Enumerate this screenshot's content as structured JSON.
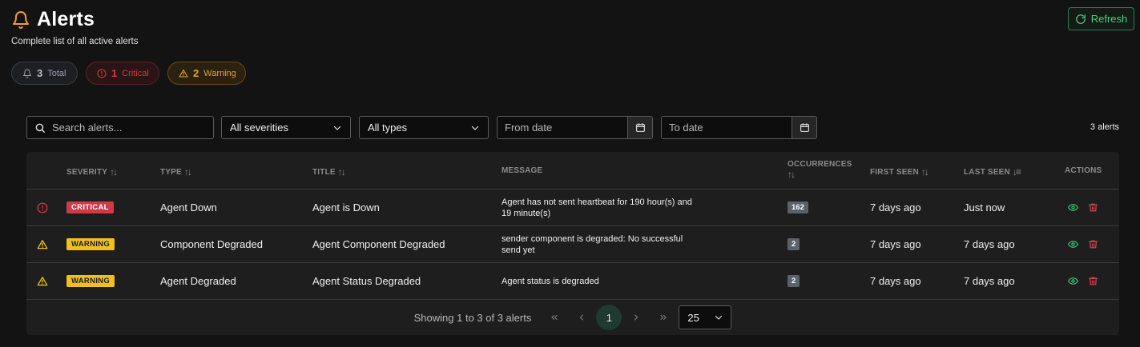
{
  "header": {
    "title": "Alerts",
    "subtitle": "Complete list of all active alerts",
    "refresh_label": "Refresh"
  },
  "summary": {
    "total": {
      "count": "3",
      "label": "Total"
    },
    "critical": {
      "count": "1",
      "label": "Critical"
    },
    "warning": {
      "count": "2",
      "label": "Warning"
    }
  },
  "filters": {
    "search_placeholder": "Search alerts...",
    "severity_selected": "All severities",
    "type_selected": "All types",
    "from_placeholder": "From date",
    "to_placeholder": "To date",
    "count_label": "3 alerts"
  },
  "table": {
    "columns": {
      "severity": "Severity",
      "type": "Type",
      "title": "Title",
      "message": "Message",
      "occurrences": "Occurrences",
      "first_seen": "First Seen",
      "last_seen": "Last Seen",
      "actions": "Actions"
    },
    "rows": [
      {
        "severity": "CRITICAL",
        "type": "Agent Down",
        "title": "Agent is Down",
        "message": "Agent has not sent heartbeat for 190 hour(s) and 19 minute(s)",
        "occurrences": "162",
        "first_seen": "7 days ago",
        "last_seen": "Just now"
      },
      {
        "severity": "WARNING",
        "type": "Component Degraded",
        "title": "Agent Component Degraded",
        "message": "sender component is degraded: No successful send yet",
        "occurrences": "2",
        "first_seen": "7 days ago",
        "last_seen": "7 days ago"
      },
      {
        "severity": "WARNING",
        "type": "Agent Degraded",
        "title": "Agent Status Degraded",
        "message": "Agent status is degraded",
        "occurrences": "2",
        "first_seen": "7 days ago",
        "last_seen": "7 days ago"
      }
    ]
  },
  "pagination": {
    "summary": "Showing 1 to 3 of 3 alerts",
    "current_page": "1",
    "page_size": "25"
  },
  "icons": {
    "bell": "bell-icon",
    "refresh": "refresh-icon",
    "critical": "alert-circle-icon",
    "warning": "warning-triangle-icon",
    "search": "search-icon",
    "calendar": "calendar-icon",
    "view": "eye-icon",
    "delete": "trash-icon"
  },
  "colors": {
    "accent_green": "#4cd080",
    "critical": "#cf3a46",
    "warning": "#f2c01d",
    "bell_orange": "#f0a020"
  }
}
